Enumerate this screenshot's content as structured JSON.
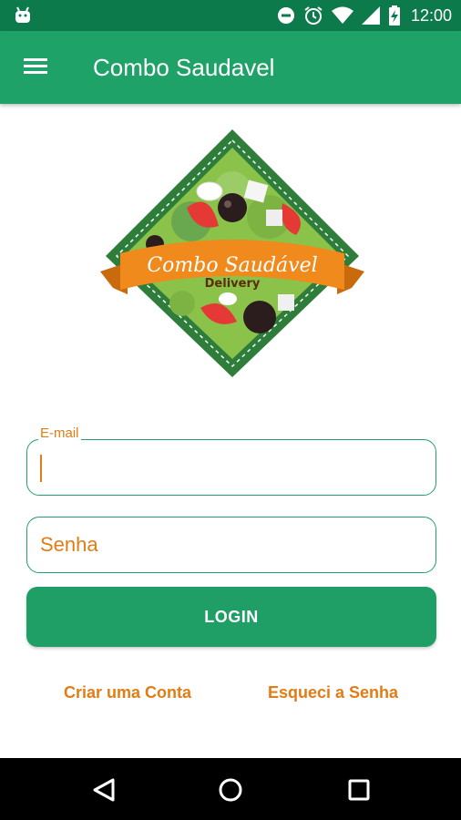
{
  "status_bar": {
    "time": "12:00",
    "icons": [
      "android-debug-icon",
      "do-not-disturb-icon",
      "alarm-icon",
      "wifi-icon",
      "signal-icon",
      "battery-charging-icon"
    ]
  },
  "app_bar": {
    "title": "Combo Saudavel",
    "menu_icon": "hamburger-menu-icon"
  },
  "logo": {
    "text_main": "Combo Saudável",
    "text_sub": "Delivery"
  },
  "form": {
    "email_label": "E-mail",
    "email_value": "",
    "password_placeholder": "Senha",
    "login_label": "LOGIN"
  },
  "links": {
    "create_account": "Criar uma Conta",
    "forgot_password": "Esqueci a Senha"
  },
  "nav_bar": {
    "icons": [
      "back-icon",
      "home-icon",
      "recents-icon"
    ]
  },
  "colors": {
    "status_bar": "#0d7a4c",
    "app_bar": "#1fa267",
    "accent_orange": "#e27c14",
    "button_green": "#1f9f66"
  }
}
